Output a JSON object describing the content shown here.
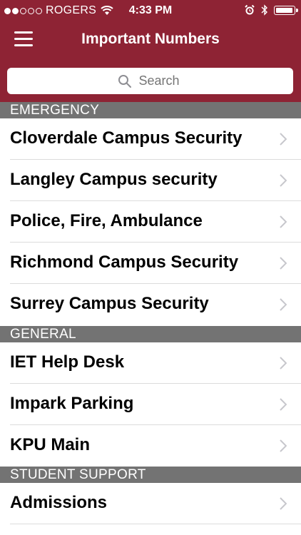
{
  "status": {
    "carrier": "ROGERS",
    "time": "4:33 PM"
  },
  "nav": {
    "title": "Important Numbers",
    "menu_icon": "hamburger-menu-icon"
  },
  "search": {
    "placeholder": "Search"
  },
  "colors": {
    "header": "#8e2334",
    "section": "#737373"
  },
  "sections": [
    {
      "title": "EMERGENCY",
      "items": [
        "Cloverdale Campus Security",
        "Langley Campus security",
        "Police, Fire, Ambulance",
        "Richmond Campus Security",
        "Surrey Campus Security"
      ]
    },
    {
      "title": "GENERAL",
      "items": [
        "IET Help Desk",
        "Impark Parking",
        "KPU Main"
      ]
    },
    {
      "title": "STUDENT SUPPORT",
      "items": [
        "Admissions"
      ]
    }
  ]
}
